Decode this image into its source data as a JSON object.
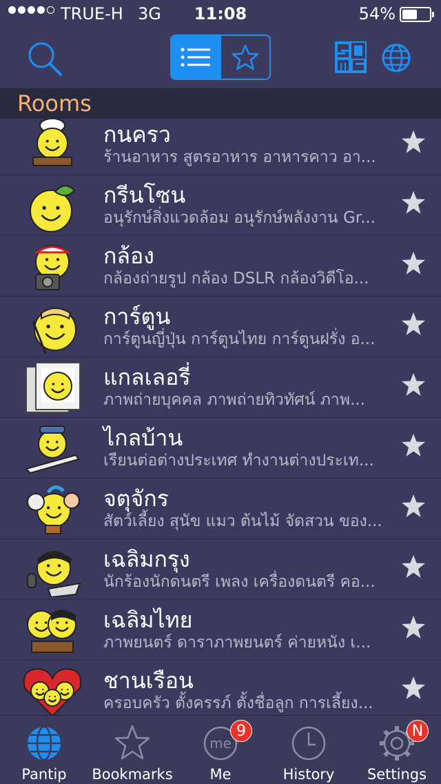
{
  "status": {
    "carrier": "TRUE-H",
    "network": "3G",
    "time": "11:08",
    "battery": "54%",
    "battery_level": 0.54,
    "signal_bars_filled": 4,
    "signal_bars_total": 5
  },
  "section": {
    "title": "Rooms"
  },
  "colors": {
    "accent": "#1e8ff0",
    "header_text": "#f4b274",
    "badge": "#e8322a"
  },
  "rooms": [
    {
      "title": "กนครว",
      "subtitle": "ร้านอาหาร สูตรอาหาร อาหารคาว อา...",
      "icon": "chef-smiley-icon"
    },
    {
      "title": "กรีนโซน",
      "subtitle": "อนุรักษ์สิ่งแวดล้อม อนุรักษ์พลังงาน Gr...",
      "icon": "leaf-smiley-icon"
    },
    {
      "title": "กล้อง",
      "subtitle": "กล้องถ่ายรูป กล้อง DSLR กล้องวิดีโอ...",
      "icon": "camera-smiley-icon"
    },
    {
      "title": "การ์ตูน",
      "subtitle": "การ์ตูนญี่ปุ่น การ์ตูนไทย การ์ตูนฝรั่ง อ...",
      "icon": "artist-smiley-icon"
    },
    {
      "title": "แกลเลอรี่",
      "subtitle": "ภาพถ่ายบุคคล ภาพถ่ายทิวทัศน์ ภาพ...",
      "icon": "photo-frame-smiley-icon"
    },
    {
      "title": "ไกลบ้าน",
      "subtitle": "เรียนต่อต่างประเทศ ทำงานต่างประเท...",
      "icon": "airplane-smiley-icon"
    },
    {
      "title": "จตุจักร",
      "subtitle": "สัตว์เลี้ยง สุนัข แมว ต้นไม้ จัดสวน ของ...",
      "icon": "pets-smiley-icon"
    },
    {
      "title": "เฉลิมกรุง",
      "subtitle": "นักร้องนักดนตรี เพลง เครื่องดนตรี คอ...",
      "icon": "singer-smiley-icon"
    },
    {
      "title": "เฉลิมไทย",
      "subtitle": "ภาพยนตร์ ดาราภาพยนตร์ ค่ายหนัง เ...",
      "icon": "movie-smiley-icon"
    },
    {
      "title": "ชานเรือน",
      "subtitle": "ครอบครัว ตั้งครรภ์ ตั้งชื่อลูก การเลี้ยง...",
      "icon": "family-heart-icon"
    }
  ],
  "tabs": [
    {
      "label": "Pantip",
      "icon": "globe-icon",
      "active": true
    },
    {
      "label": "Bookmarks",
      "icon": "star-icon"
    },
    {
      "label": "Me",
      "icon": "me-icon",
      "badge": "9",
      "icon_text": "me"
    },
    {
      "label": "History",
      "icon": "clock-icon"
    },
    {
      "label": "Settings",
      "icon": "gear-icon",
      "badge": "N"
    }
  ]
}
